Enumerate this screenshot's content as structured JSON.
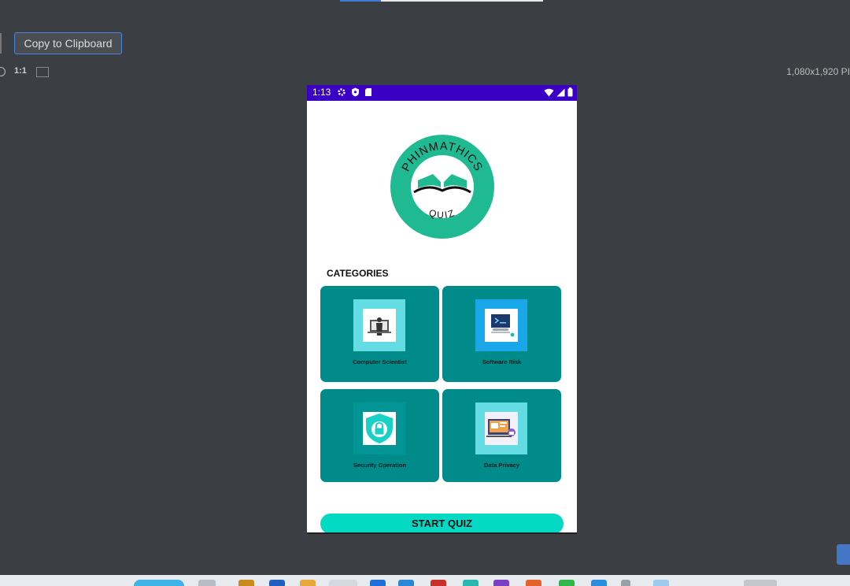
{
  "toolbar": {
    "copy_label": "Copy to Clipboard",
    "zoom_label": "1:1",
    "dimensions": "1,080x1,920 PI"
  },
  "phone": {
    "status_bar": {
      "time": "1:13",
      "color": "#3a00c4",
      "icons": [
        "gear-icon",
        "shield-icon",
        "sd-card-icon"
      ],
      "system_icons": [
        "wifi-icon",
        "signal-icon",
        "battery-icon"
      ]
    },
    "logo": {
      "top_text": "PHINMATHICS",
      "bottom_text": "QUIZ",
      "ring_color": "#1fb992",
      "icon": "open-book-icon"
    },
    "categories_title": "CATEGORIES",
    "categories": [
      {
        "label": "Computer Scientist",
        "icon": "computer-scientist-icon",
        "thumb_color": "#63dde3"
      },
      {
        "label": "Software Risk",
        "icon": "software-risk-icon",
        "thumb_color": "#1aa7ea"
      },
      {
        "label": "Security Operation",
        "icon": "security-shield-icon",
        "thumb_color": "#029595"
      },
      {
        "label": "Data Privacy",
        "icon": "data-privacy-icon",
        "thumb_color": "#63dde3"
      }
    ],
    "card_color": "#008b8b",
    "start_button": "START QUIZ",
    "start_color": "#04d9c4"
  }
}
